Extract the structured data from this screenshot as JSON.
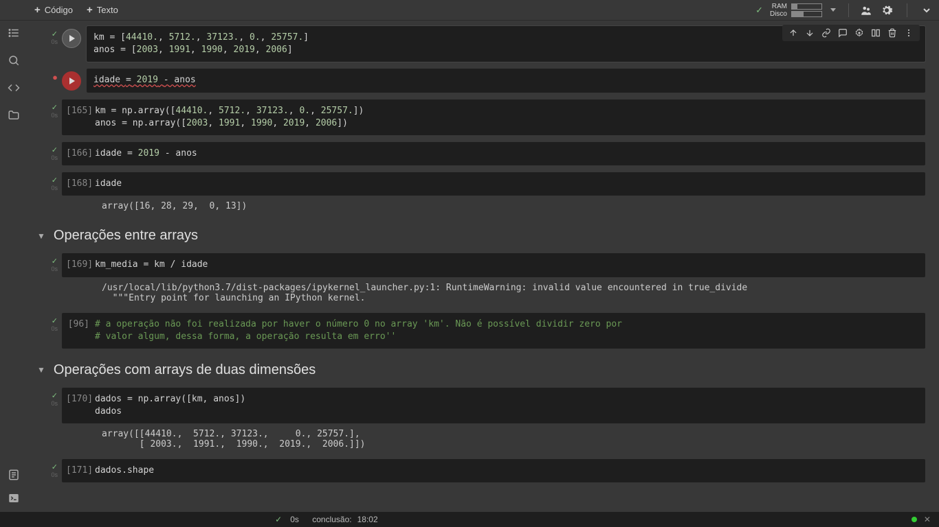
{
  "toolbar": {
    "add_code": "Código",
    "add_text": "Texto",
    "ram_label": "RAM",
    "disk_label": "Disco",
    "ram_pct": 18,
    "disk_pct": 40
  },
  "cells": [
    {
      "type": "code",
      "active": true,
      "run_button": true,
      "status": "ok",
      "time": "0s",
      "prompt": "",
      "code_html": "km <span class='op'>=</span> [<span class='num'>44410.</span>, <span class='num'>5712.</span>, <span class='num'>37123.</span>, <span class='num'>0.</span>, <span class='num'>25757.</span>]\nanos <span class='op'>=</span> [<span class='num'>2003</span>, <span class='num'>1991</span>, <span class='num'>1990</span>, <span class='num'>2019</span>, <span class='num'>2006</span>]",
      "output": ""
    },
    {
      "type": "code",
      "run_button": true,
      "run_error": true,
      "status": "error",
      "time": "",
      "prompt": "",
      "code_html": "<span class='err-underline'>idade <span class='op'>=</span> <span class='num'>2019</span> <span class='op'>-</span> anos</span>",
      "output": ""
    },
    {
      "type": "code",
      "status": "ok",
      "time": "0s",
      "prompt": "[165]",
      "code_html": "km <span class='op'>=</span> np.array([<span class='num'>44410.</span>, <span class='num'>5712.</span>, <span class='num'>37123.</span>, <span class='num'>0.</span>, <span class='num'>25757.</span>])\nanos <span class='op'>=</span> np.array([<span class='num'>2003</span>, <span class='num'>1991</span>, <span class='num'>1990</span>, <span class='num'>2019</span>, <span class='num'>2006</span>])",
      "output": ""
    },
    {
      "type": "code",
      "status": "ok",
      "time": "0s",
      "prompt": "[166]",
      "code_html": "idade <span class='op'>=</span> <span class='num'>2019</span> <span class='op'>-</span> anos",
      "output": ""
    },
    {
      "type": "code",
      "status": "ok",
      "time": "0s",
      "prompt": "[168]",
      "code_html": "idade",
      "output": "array([16, 28, 29,  0, 13])"
    },
    {
      "type": "heading",
      "text": "Operações entre arrays"
    },
    {
      "type": "code",
      "status": "ok",
      "time": "0s",
      "prompt": "[169]",
      "code_html": "km_media <span class='op'>=</span> km <span class='op'>/</span> idade",
      "output": "/usr/local/lib/python3.7/dist-packages/ipykernel_launcher.py:1: RuntimeWarning: invalid value encountered in true_divide\n  \"\"\"Entry point for launching an IPython kernel."
    },
    {
      "type": "code",
      "status": "ok",
      "time": "0s",
      "prompt": "[96]",
      "code_html": "<span class='comment'># a operação não foi realizada por haver o número 0 no array 'km'. Não é possível dividir zero por</span>\n<span class='comment'># valor algum, dessa forma, a operação resulta em erro''</span>",
      "output": ""
    },
    {
      "type": "heading",
      "text": "Operações com arrays de duas dimensões"
    },
    {
      "type": "code",
      "status": "ok",
      "time": "0s",
      "prompt": "[170]",
      "code_html": "dados <span class='op'>=</span> np.array([km, anos])\ndados",
      "output": "array([[44410.,  5712., 37123.,     0., 25757.],\n       [ 2003.,  1991.,  1990.,  2019.,  2006.]])"
    },
    {
      "type": "code",
      "status": "ok",
      "time": "0s",
      "prompt": "[171]",
      "code_html": "dados.shape",
      "output": ""
    }
  ],
  "cell_toolbar_icons": [
    "move-up",
    "move-down",
    "link",
    "comment",
    "settings",
    "mirror",
    "delete",
    "more"
  ],
  "status": {
    "duration": "0s",
    "completion_label": "conclusão:",
    "completion_time": "18:02"
  }
}
